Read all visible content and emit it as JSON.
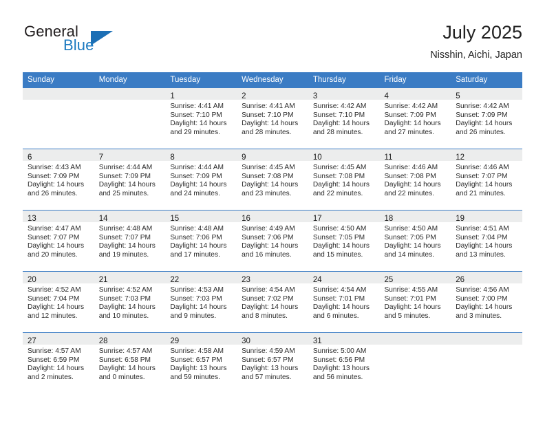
{
  "brand": {
    "word1": "General",
    "word2": "Blue",
    "logo_icon": "triangle-flag-icon",
    "accent_color": "#1c7ac0"
  },
  "header": {
    "title": "July 2025",
    "subtitle": "Nisshin, Aichi, Japan"
  },
  "theme": {
    "header_bg": "#3b7cc4",
    "daynum_bg": "#eceded",
    "row_separator": "#3b7cc4",
    "text": "#2a2a2a"
  },
  "weekday_headers": [
    "Sunday",
    "Monday",
    "Tuesday",
    "Wednesday",
    "Thursday",
    "Friday",
    "Saturday"
  ],
  "labels": {
    "sunrise_prefix": "Sunrise:",
    "sunset_prefix": "Sunset:",
    "daylight_prefix": "Daylight:"
  },
  "weeks": [
    [
      {
        "day": "",
        "sunrise": "",
        "sunset": "",
        "daylight1": "",
        "daylight2": ""
      },
      {
        "day": "",
        "sunrise": "",
        "sunset": "",
        "daylight1": "",
        "daylight2": ""
      },
      {
        "day": "1",
        "sunrise": "Sunrise: 4:41 AM",
        "sunset": "Sunset: 7:10 PM",
        "daylight1": "Daylight: 14 hours",
        "daylight2": "and 29 minutes."
      },
      {
        "day": "2",
        "sunrise": "Sunrise: 4:41 AM",
        "sunset": "Sunset: 7:10 PM",
        "daylight1": "Daylight: 14 hours",
        "daylight2": "and 28 minutes."
      },
      {
        "day": "3",
        "sunrise": "Sunrise: 4:42 AM",
        "sunset": "Sunset: 7:10 PM",
        "daylight1": "Daylight: 14 hours",
        "daylight2": "and 28 minutes."
      },
      {
        "day": "4",
        "sunrise": "Sunrise: 4:42 AM",
        "sunset": "Sunset: 7:09 PM",
        "daylight1": "Daylight: 14 hours",
        "daylight2": "and 27 minutes."
      },
      {
        "day": "5",
        "sunrise": "Sunrise: 4:42 AM",
        "sunset": "Sunset: 7:09 PM",
        "daylight1": "Daylight: 14 hours",
        "daylight2": "and 26 minutes."
      }
    ],
    [
      {
        "day": "6",
        "sunrise": "Sunrise: 4:43 AM",
        "sunset": "Sunset: 7:09 PM",
        "daylight1": "Daylight: 14 hours",
        "daylight2": "and 26 minutes."
      },
      {
        "day": "7",
        "sunrise": "Sunrise: 4:44 AM",
        "sunset": "Sunset: 7:09 PM",
        "daylight1": "Daylight: 14 hours",
        "daylight2": "and 25 minutes."
      },
      {
        "day": "8",
        "sunrise": "Sunrise: 4:44 AM",
        "sunset": "Sunset: 7:09 PM",
        "daylight1": "Daylight: 14 hours",
        "daylight2": "and 24 minutes."
      },
      {
        "day": "9",
        "sunrise": "Sunrise: 4:45 AM",
        "sunset": "Sunset: 7:08 PM",
        "daylight1": "Daylight: 14 hours",
        "daylight2": "and 23 minutes."
      },
      {
        "day": "10",
        "sunrise": "Sunrise: 4:45 AM",
        "sunset": "Sunset: 7:08 PM",
        "daylight1": "Daylight: 14 hours",
        "daylight2": "and 22 minutes."
      },
      {
        "day": "11",
        "sunrise": "Sunrise: 4:46 AM",
        "sunset": "Sunset: 7:08 PM",
        "daylight1": "Daylight: 14 hours",
        "daylight2": "and 22 minutes."
      },
      {
        "day": "12",
        "sunrise": "Sunrise: 4:46 AM",
        "sunset": "Sunset: 7:07 PM",
        "daylight1": "Daylight: 14 hours",
        "daylight2": "and 21 minutes."
      }
    ],
    [
      {
        "day": "13",
        "sunrise": "Sunrise: 4:47 AM",
        "sunset": "Sunset: 7:07 PM",
        "daylight1": "Daylight: 14 hours",
        "daylight2": "and 20 minutes."
      },
      {
        "day": "14",
        "sunrise": "Sunrise: 4:48 AM",
        "sunset": "Sunset: 7:07 PM",
        "daylight1": "Daylight: 14 hours",
        "daylight2": "and 19 minutes."
      },
      {
        "day": "15",
        "sunrise": "Sunrise: 4:48 AM",
        "sunset": "Sunset: 7:06 PM",
        "daylight1": "Daylight: 14 hours",
        "daylight2": "and 17 minutes."
      },
      {
        "day": "16",
        "sunrise": "Sunrise: 4:49 AM",
        "sunset": "Sunset: 7:06 PM",
        "daylight1": "Daylight: 14 hours",
        "daylight2": "and 16 minutes."
      },
      {
        "day": "17",
        "sunrise": "Sunrise: 4:50 AM",
        "sunset": "Sunset: 7:05 PM",
        "daylight1": "Daylight: 14 hours",
        "daylight2": "and 15 minutes."
      },
      {
        "day": "18",
        "sunrise": "Sunrise: 4:50 AM",
        "sunset": "Sunset: 7:05 PM",
        "daylight1": "Daylight: 14 hours",
        "daylight2": "and 14 minutes."
      },
      {
        "day": "19",
        "sunrise": "Sunrise: 4:51 AM",
        "sunset": "Sunset: 7:04 PM",
        "daylight1": "Daylight: 14 hours",
        "daylight2": "and 13 minutes."
      }
    ],
    [
      {
        "day": "20",
        "sunrise": "Sunrise: 4:52 AM",
        "sunset": "Sunset: 7:04 PM",
        "daylight1": "Daylight: 14 hours",
        "daylight2": "and 12 minutes."
      },
      {
        "day": "21",
        "sunrise": "Sunrise: 4:52 AM",
        "sunset": "Sunset: 7:03 PM",
        "daylight1": "Daylight: 14 hours",
        "daylight2": "and 10 minutes."
      },
      {
        "day": "22",
        "sunrise": "Sunrise: 4:53 AM",
        "sunset": "Sunset: 7:03 PM",
        "daylight1": "Daylight: 14 hours",
        "daylight2": "and 9 minutes."
      },
      {
        "day": "23",
        "sunrise": "Sunrise: 4:54 AM",
        "sunset": "Sunset: 7:02 PM",
        "daylight1": "Daylight: 14 hours",
        "daylight2": "and 8 minutes."
      },
      {
        "day": "24",
        "sunrise": "Sunrise: 4:54 AM",
        "sunset": "Sunset: 7:01 PM",
        "daylight1": "Daylight: 14 hours",
        "daylight2": "and 6 minutes."
      },
      {
        "day": "25",
        "sunrise": "Sunrise: 4:55 AM",
        "sunset": "Sunset: 7:01 PM",
        "daylight1": "Daylight: 14 hours",
        "daylight2": "and 5 minutes."
      },
      {
        "day": "26",
        "sunrise": "Sunrise: 4:56 AM",
        "sunset": "Sunset: 7:00 PM",
        "daylight1": "Daylight: 14 hours",
        "daylight2": "and 3 minutes."
      }
    ],
    [
      {
        "day": "27",
        "sunrise": "Sunrise: 4:57 AM",
        "sunset": "Sunset: 6:59 PM",
        "daylight1": "Daylight: 14 hours",
        "daylight2": "and 2 minutes."
      },
      {
        "day": "28",
        "sunrise": "Sunrise: 4:57 AM",
        "sunset": "Sunset: 6:58 PM",
        "daylight1": "Daylight: 14 hours",
        "daylight2": "and 0 minutes."
      },
      {
        "day": "29",
        "sunrise": "Sunrise: 4:58 AM",
        "sunset": "Sunset: 6:57 PM",
        "daylight1": "Daylight: 13 hours",
        "daylight2": "and 59 minutes."
      },
      {
        "day": "30",
        "sunrise": "Sunrise: 4:59 AM",
        "sunset": "Sunset: 6:57 PM",
        "daylight1": "Daylight: 13 hours",
        "daylight2": "and 57 minutes."
      },
      {
        "day": "31",
        "sunrise": "Sunrise: 5:00 AM",
        "sunset": "Sunset: 6:56 PM",
        "daylight1": "Daylight: 13 hours",
        "daylight2": "and 56 minutes."
      },
      {
        "day": "",
        "sunrise": "",
        "sunset": "",
        "daylight1": "",
        "daylight2": ""
      },
      {
        "day": "",
        "sunrise": "",
        "sunset": "",
        "daylight1": "",
        "daylight2": ""
      }
    ]
  ]
}
